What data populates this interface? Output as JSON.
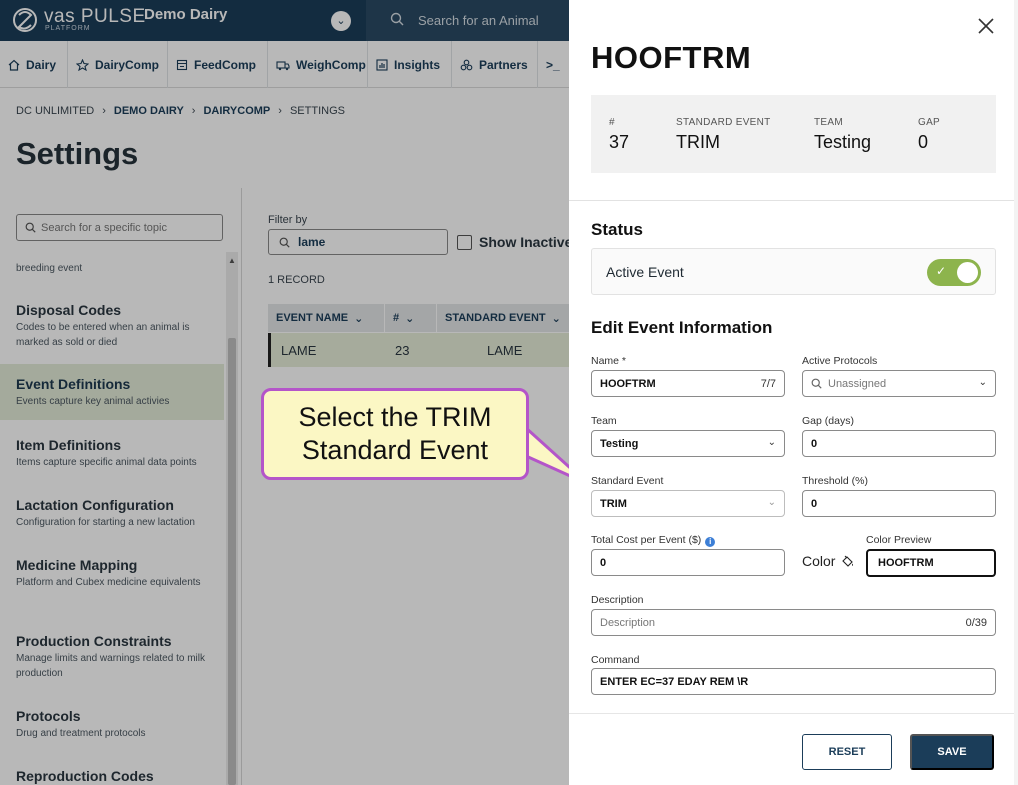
{
  "app": {
    "logo_text": "vas PULSE",
    "logo_sub": "PLATFORM",
    "farm_name": "Demo Dairy",
    "search_placeholder": "Search for an Animal"
  },
  "nav": [
    {
      "label": "Dairy",
      "icon": "home-icon"
    },
    {
      "label": "DairyComp",
      "icon": "star-icon"
    },
    {
      "label": "FeedComp",
      "icon": "feed-icon"
    },
    {
      "label": "WeighComp",
      "icon": "truck-icon"
    },
    {
      "label": "Insights",
      "icon": "chart-icon"
    },
    {
      "label": "Partners",
      "icon": "partners-icon"
    },
    {
      "label": ">_",
      "icon": "terminal-icon"
    }
  ],
  "breadcrumb": [
    "DC UNLIMITED",
    "DEMO DAIRY",
    "DAIRYCOMP",
    "SETTINGS"
  ],
  "page_title": "Settings",
  "sidebar": {
    "search_placeholder": "Search for a specific topic",
    "partial_desc": "breeding event",
    "items": [
      {
        "title": "Disposal Codes",
        "desc": "Codes to be entered when an animal is marked as sold or died"
      },
      {
        "title": "Event Definitions",
        "desc": "Events capture key animal activies"
      },
      {
        "title": "Item Definitions",
        "desc": "Items capture specific animal data points"
      },
      {
        "title": "Lactation Configuration",
        "desc": "Configuration for starting a new lactation"
      },
      {
        "title": "Medicine Mapping",
        "desc": "Platform and Cubex medicine equivalents"
      },
      {
        "title": "Production Constraints",
        "desc": "Manage limits and warnings related to milk production"
      },
      {
        "title": "Protocols",
        "desc": "Drug and treatment protocols"
      },
      {
        "title": "Reproduction Codes",
        "desc": ""
      }
    ]
  },
  "content": {
    "filter_label": "Filter by",
    "filter_value": "lame",
    "show_inactive": "Show Inactive",
    "record_count": "1 RECORD",
    "columns": [
      "EVENT NAME",
      "#",
      "STANDARD EVENT"
    ],
    "rows": [
      [
        "LAME",
        "23",
        "LAME"
      ]
    ]
  },
  "callout": {
    "text": "Select the TRIM Standard Event"
  },
  "drawer": {
    "title": "HOOFTRM",
    "summary": [
      {
        "label": "#",
        "value": "37"
      },
      {
        "label": "STANDARD EVENT",
        "value": "TRIM"
      },
      {
        "label": "TEAM",
        "value": "Testing"
      },
      {
        "label": "GAP",
        "value": "0"
      }
    ],
    "status_heading": "Status",
    "active_event_label": "Active Event",
    "active_event_on": true,
    "edit_heading": "Edit Event Information",
    "fields": {
      "name_label": "Name *",
      "name_value": "HOOFTRM",
      "name_count": "7/7",
      "protocols_label": "Active Protocols",
      "protocols_placeholder": "Unassigned",
      "team_label": "Team",
      "team_value": "Testing",
      "gap_label": "Gap (days)",
      "gap_value": "0",
      "standard_event_label": "Standard Event",
      "standard_event_value": "TRIM",
      "threshold_label": "Threshold (%)",
      "threshold_value": "0",
      "cost_label": "Total Cost per Event ($)",
      "cost_value": "0",
      "color_label": "Color",
      "color_preview_label": "Color Preview",
      "color_preview_value": "HOOFTRM",
      "description_label": "Description",
      "description_placeholder": "Description",
      "description_count": "0/39",
      "command_label": "Command",
      "command_value": "ENTER EC=37 EDAY REM \\R"
    },
    "reset_label": "RESET",
    "save_label": "SAVE"
  },
  "colors": {
    "brand_navy": "#1b3d59",
    "active_green": "#8db44d",
    "callout_border": "#b455c9",
    "callout_fill": "#fbf7c4"
  }
}
